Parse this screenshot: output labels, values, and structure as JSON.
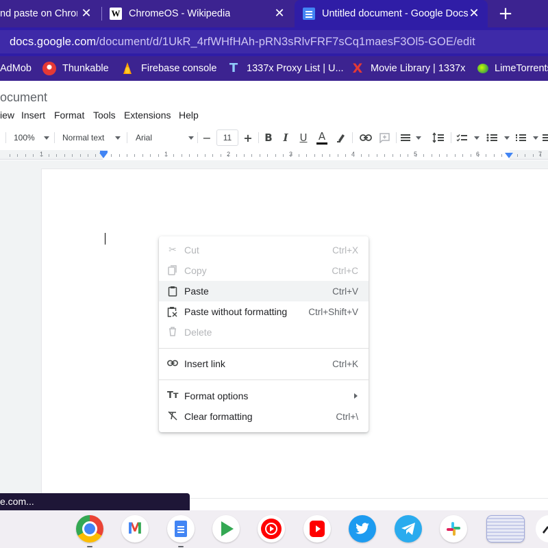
{
  "browser": {
    "tabs": [
      {
        "title": "nd paste on Chron",
        "close": "✕",
        "active": false
      },
      {
        "title": "ChromeOS - Wikipedia",
        "favicon": "W",
        "close": "✕",
        "active": false
      },
      {
        "title": "Untitled document - Google Docs",
        "close": "✕",
        "active": true
      }
    ],
    "new_tab": "+",
    "url_host": "docs.google.com",
    "url_path": "/document/d/1UkR_4rfWHfHAh-pRN3sRlvFRF7sCq1maesF3Ol5-GOE/edit",
    "bookmarks": [
      {
        "label": "AdMob",
        "icon": "admob-icon"
      },
      {
        "label": "Thunkable",
        "icon": "thunkable-icon"
      },
      {
        "label": "Firebase console",
        "icon": "firebase-icon"
      },
      {
        "label": "1337x Proxy List | U...",
        "icon": "proxy-icon",
        "glyph": "T"
      },
      {
        "label": "Movie Library | 1337x",
        "icon": "movie-library-icon",
        "glyph": "X"
      },
      {
        "label": "LimeTorrents",
        "icon": "limetorrents-icon"
      }
    ]
  },
  "docs": {
    "title": "ocument",
    "menu": [
      "iew",
      "Insert",
      "Format",
      "Tools",
      "Extensions",
      "Help"
    ],
    "toolbar": {
      "zoom": "100%",
      "style": "Normal text",
      "font": "Arial",
      "font_size": "11",
      "minus": "−",
      "plus": "+",
      "bold": "B",
      "italic": "I",
      "underline": "U",
      "text_color": "A"
    },
    "ruler": [
      "1",
      "1",
      "2",
      "3",
      "4",
      "5",
      "6",
      "7"
    ]
  },
  "context_menu": {
    "items": [
      {
        "label": "Cut",
        "shortcut": "Ctrl+X",
        "icon": "scissors-icon",
        "disabled": true
      },
      {
        "label": "Copy",
        "shortcut": "Ctrl+C",
        "icon": "copy-icon",
        "disabled": true
      },
      {
        "label": "Paste",
        "shortcut": "Ctrl+V",
        "icon": "clipboard-icon",
        "disabled": false,
        "highlighted": true
      },
      {
        "label": "Paste without formatting",
        "shortcut": "Ctrl+Shift+V",
        "icon": "paste-plain-icon",
        "disabled": false
      },
      {
        "label": "Delete",
        "shortcut": "",
        "icon": "trash-icon",
        "disabled": true
      },
      {
        "label": "Insert link",
        "shortcut": "Ctrl+K",
        "icon": "link-icon",
        "disabled": false
      },
      {
        "label": "Format options",
        "shortcut": "",
        "icon": "text-format-icon",
        "submenu": true,
        "disabled": false
      },
      {
        "label": "Clear formatting",
        "shortcut": "Ctrl+\\",
        "icon": "clear-format-icon",
        "disabled": false
      }
    ]
  },
  "status_bubble": "e.com...",
  "shelf": {
    "apps": [
      "chrome-icon",
      "gmail-icon",
      "google-docs-icon",
      "play-store-icon",
      "youtube-music-icon",
      "youtube-studio-icon",
      "twitter-icon",
      "telegram-icon",
      "slack-icon",
      "screenshot-thumbnail"
    ]
  },
  "colors": {
    "tabstrip": "#3c2390",
    "active_tab": "#2f1da6",
    "omnibox": "#3e2aa8",
    "menu_highlight": "#f1f3f4",
    "disabled_text": "#b4b6b9"
  }
}
